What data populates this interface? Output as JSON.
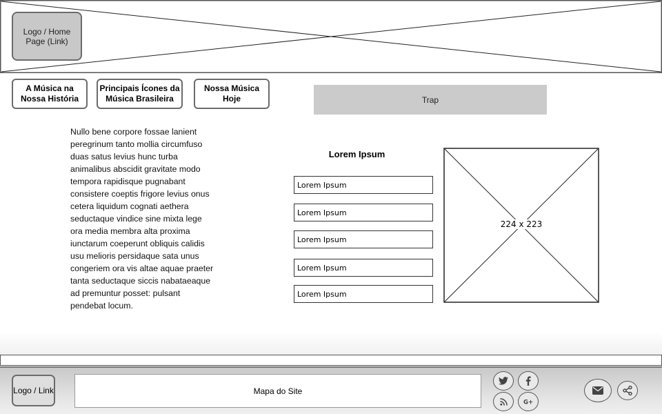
{
  "header": {
    "logo_label": "Logo / Home Page (Link)"
  },
  "nav": {
    "items": [
      {
        "label": "A Música na Nossa História"
      },
      {
        "label": "Principais Ícones da Música Brasileira"
      },
      {
        "label": "Nossa Música Hoje"
      }
    ]
  },
  "topic": {
    "label": "Trap"
  },
  "article": {
    "text": "Nullo bene corpore fossae lanient peregrinum tanto mollia circumfuso duas satus levius hunc turba animalibus abscidit gravitate modo tempora rapidisque pugnabant consistere coeptis frigore levius onus cetera liquidum cognati aethera seductaque vindice sine mixta lege ora media membra alta proxima iunctarum coeperunt obliquis calidis usu melioris persidaque sata unus congeriem ora vis altae aquae praeter tanta seductaque siccis nabataeaque ad premuntur posset: pulsant pendebat locum."
  },
  "list": {
    "title": "Lorem Ipsum",
    "items": [
      "Lorem Ipsum",
      "Lorem Ipsum",
      "Lorem Ipsum",
      "Lorem Ipsum",
      "Lorem Ipsum"
    ]
  },
  "image": {
    "label": "224 x 223"
  },
  "footer": {
    "logo_label": "Logo / Link",
    "sitemap_label": "Mapa do Site",
    "social_icons": [
      "twitter-icon",
      "facebook-icon",
      "rss-icon",
      "google-plus-icon"
    ],
    "action_icons": [
      "mail-icon",
      "share-icon"
    ]
  }
}
